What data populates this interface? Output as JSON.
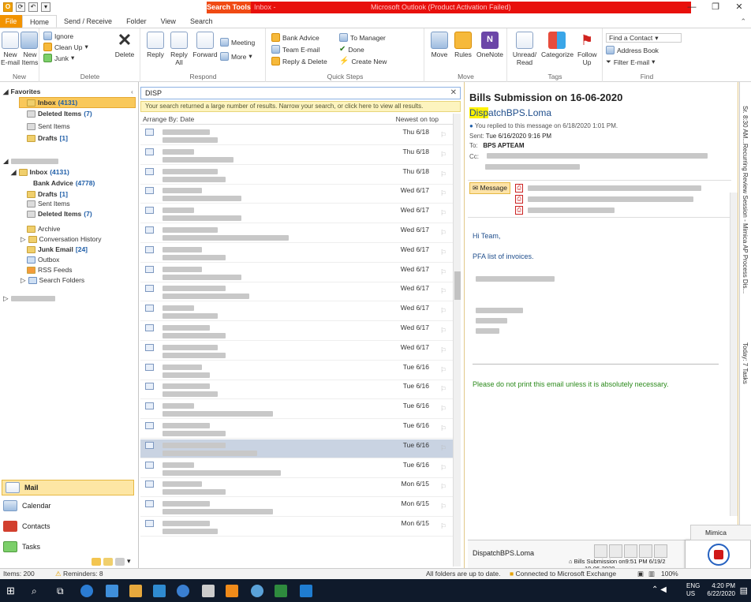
{
  "window": {
    "context_tab": "Search Tools",
    "title_left": "Inbox - ",
    "title_right": "Microsoft Outlook (Product Activation Failed)"
  },
  "tabs": [
    "File",
    "Home",
    "Send / Receive",
    "Folder",
    "View",
    "Search"
  ],
  "ribbon": {
    "new_email": "New E-mail",
    "new_items": "New Items",
    "group_new": "New",
    "ignore": "Ignore",
    "clean_up": "Clean Up",
    "junk": "Junk",
    "delete": "Delete",
    "group_delete": "Delete",
    "reply": "Reply",
    "reply_all": "Reply All",
    "forward": "Forward",
    "meeting": "Meeting",
    "more": "More",
    "group_respond": "Respond",
    "qs_bank_advice": "Bank Advice",
    "qs_team_email": "Team E-mail",
    "qs_reply_delete": "Reply & Delete",
    "qs_to_manager": "To Manager",
    "qs_done": "Done",
    "qs_create_new": "Create New",
    "group_quick_steps": "Quick Steps",
    "move": "Move",
    "rules": "Rules",
    "onenote": "OneNote",
    "group_move": "Move",
    "unread_read": "Unread/ Read",
    "categorize": "Categorize",
    "follow_up": "Follow Up",
    "group_tags": "Tags",
    "find_contact": "Find a Contact",
    "address_book": "Address Book",
    "filter_email": "Filter E-mail",
    "group_find": "Find"
  },
  "nav": {
    "favorites": "Favorites",
    "fav_inbox": "Inbox",
    "fav_inbox_count": "(4131)",
    "fav_deleted": "Deleted Items",
    "fav_deleted_count": "(7)",
    "fav_sent": "Sent Items",
    "fav_drafts": "Drafts",
    "fav_drafts_count": "[1]",
    "inbox": "Inbox",
    "inbox_count": "(4131)",
    "bank_advice": "Bank Advice",
    "bank_advice_count": "(4778)",
    "drafts": "Drafts",
    "drafts_count": "[1]",
    "sent": "Sent Items",
    "deleted": "Deleted Items",
    "deleted_count": "(7)",
    "archive": "Archive",
    "conv_history": "Conversation History",
    "junk": "Junk Email",
    "junk_count": "[24]",
    "outbox": "Outbox",
    "rss": "RSS Feeds",
    "search_folders": "Search Folders",
    "modules": [
      "Mail",
      "Calendar",
      "Contacts",
      "Tasks"
    ]
  },
  "list": {
    "search_query": "DISP",
    "notice": "Your search returned a large number of results. Narrow your search, or click here to view all results.",
    "arrange_by": "Arrange By: Date",
    "sort": "Newest on top",
    "dates": [
      "Thu 6/18",
      "Thu 6/18",
      "Thu 6/18",
      "Wed 6/17",
      "Wed 6/17",
      "Wed 6/17",
      "Wed 6/17",
      "Wed 6/17",
      "Wed 6/17",
      "Wed 6/17",
      "Wed 6/17",
      "Wed 6/17",
      "Tue 6/16",
      "Tue 6/16",
      "Tue 6/16",
      "Tue 6/16",
      "Tue 6/16",
      "Tue 6/16",
      "Mon 6/15",
      "Mon 6/15",
      "Mon 6/15"
    ]
  },
  "reading": {
    "subject": "Bills Submission on 16-06-2020",
    "sender_highlight": "Disp",
    "sender_rest": "atchBPS.Loma",
    "replied": "You replied to this message on 6/18/2020 1:01 PM.",
    "sent_label": "Sent:",
    "sent_value": "Tue 6/16/2020 9:16 PM",
    "to_label": "To:",
    "to_value": "BPS APTEAM",
    "cc_label": "Cc:",
    "message_tab": "Message",
    "greeting": "Hi Team,",
    "line1": "PFA list of invoices.",
    "footer": "Please do not print this email unless it is absolutely necessary.",
    "people_name": "DispatchBPS.Loma",
    "people_item": "Bills Submission on",
    "people_item_time": "9:51 PM 6/19/2",
    "people_item_date": "19-06-2020"
  },
  "todo": {
    "text1": "Sr. 8:30 AM...Recurring Review Session - Mimica AP Process Dis...",
    "text2": "Today: 7 Tasks"
  },
  "mimica": {
    "title": "Mimica"
  },
  "status": {
    "items": "Items: 200",
    "reminders": "Reminders: 8",
    "folders_uptodate": "All folders are up to date.",
    "connected": "Connected to Microsoft Exchange",
    "zoom": "100%"
  },
  "taskbar": {
    "lang1": "ENG",
    "lang2": "US",
    "time": "4:20 PM",
    "date": "6/22/2020"
  }
}
